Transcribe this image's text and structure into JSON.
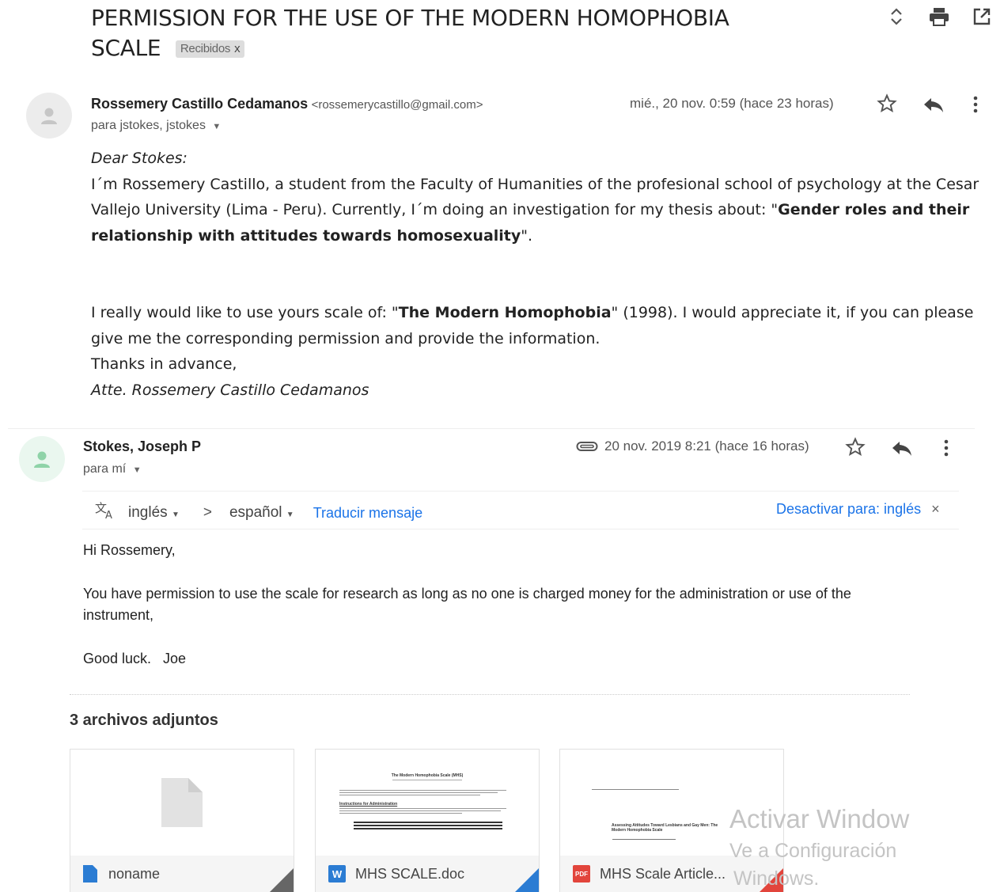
{
  "subject": {
    "line1": "PERMISSION FOR THE USE OF THE MODERN HOMOPHOBIA",
    "line2": "SCALE",
    "label": "Recibidos",
    "label_close": "x"
  },
  "message1": {
    "sender_name": "Rossemery Castillo Cedamanos",
    "sender_email": "<rossemerycastillo@gmail.com>",
    "recipients": "para jstokes, jstokes",
    "date": "mié., 20 nov. 0:59 (hace 23 horas)",
    "greeting": "Dear Stokes:",
    "p1_before": "I´m Rossemery Castillo, a student from the Faculty of Humanities of the profesional school of psychology at the Cesar Vallejo University (Lima - Peru). Currently, I´m doing an investigation for my thesis about: \"",
    "p1_bold": "Gender roles and their relationship with attitudes towards homosexuality",
    "p1_after": "\".",
    "p2_before": "I really would like to use yours scale of: \"",
    "p2_bold": "The Modern Homophobia",
    "p2_after": "\" (1998). I would appreciate it, if you can please give me the corresponding permission and provide the information.",
    "thanks": "Thanks in advance,",
    "signature": "Atte. Rossemery Castillo Cedamanos"
  },
  "message2": {
    "sender_name": "Stokes, Joseph P",
    "recipients": "para mí",
    "date": "20 nov. 2019 8:21 (hace 16 horas)",
    "translate": {
      "from": "inglés",
      "arrow": ">",
      "to": "español",
      "action": "Traducir mensaje",
      "disable": "Desactivar para: inglés",
      "close": "×"
    },
    "line1": "Hi Rossemery,",
    "line2": "You have permission to use the scale for research as long as no one is charged money for the administration or use of the instrument,",
    "line3": "Good luck.   Joe"
  },
  "attachments": {
    "title": "3 archivos adjuntos",
    "items": [
      {
        "name": "noname",
        "icon": "doc-blue-icon"
      },
      {
        "name": "MHS SCALE.doc",
        "icon": "word-icon",
        "badge": "W"
      },
      {
        "name": "MHS Scale Article...",
        "icon": "pdf-icon",
        "badge": "PDF"
      }
    ],
    "preview2": {
      "title": "The Modern Homophobia Scale (MHS)",
      "heading": "Instructions for Administration"
    },
    "preview3": {
      "title": "Assessing Attitudes Toward Lesbians and Gay Men: The Modern Homophobia Scale"
    }
  },
  "watermark": {
    "line1": "Activar Window",
    "line2": "Ve a Configuración",
    "line3": "Windows."
  },
  "colors": {
    "link": "#1a73e8",
    "avatar_green": "#8fd3a8",
    "word_blue": "#2b7cd3",
    "pdf_red": "#e2453c"
  }
}
